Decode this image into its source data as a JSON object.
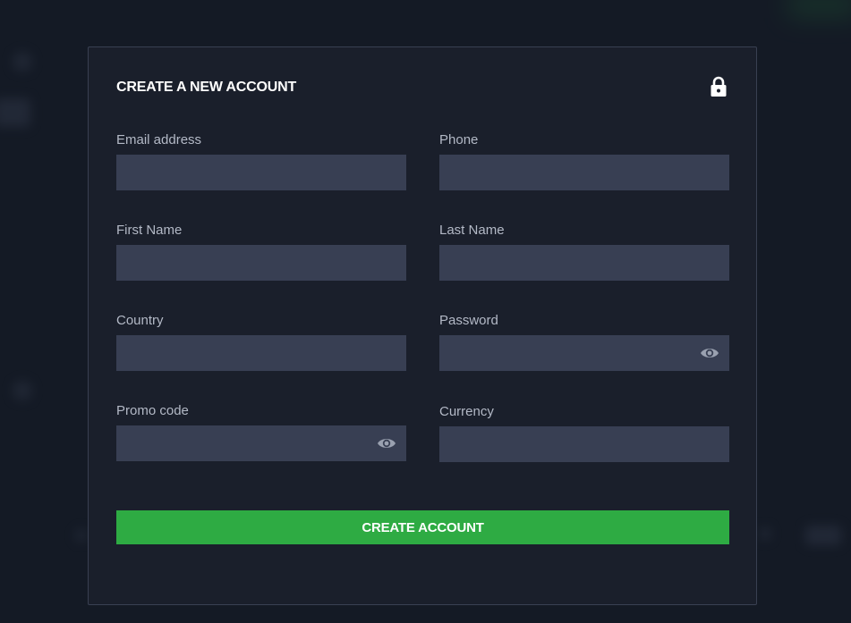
{
  "form": {
    "title": "CREATE A NEW ACCOUNT",
    "lock_icon": "lock-icon",
    "fields": {
      "email": {
        "label": "Email address",
        "value": "",
        "placeholder": ""
      },
      "phone": {
        "label": "Phone",
        "value": "",
        "placeholder": ""
      },
      "first_name": {
        "label": "First Name",
        "value": "",
        "placeholder": ""
      },
      "last_name": {
        "label": "Last Name",
        "value": "",
        "placeholder": ""
      },
      "country": {
        "label": "Country",
        "value": "",
        "placeholder": ""
      },
      "password": {
        "label": "Password",
        "value": "",
        "placeholder": "",
        "toggle_icon": "eye-icon"
      },
      "promo_code": {
        "label": "Promo code",
        "value": "",
        "placeholder": "",
        "toggle_icon": "eye-icon"
      },
      "currency": {
        "label": "Currency",
        "value": "",
        "placeholder": ""
      }
    },
    "submit_label": "CREATE ACCOUNT"
  },
  "colors": {
    "background": "#141a25",
    "panel": "#1a1f2b",
    "panel_border": "#394052",
    "input": "#383f53",
    "label": "#b3b9c6",
    "accent": "#2eab43",
    "text": "#ffffff"
  }
}
